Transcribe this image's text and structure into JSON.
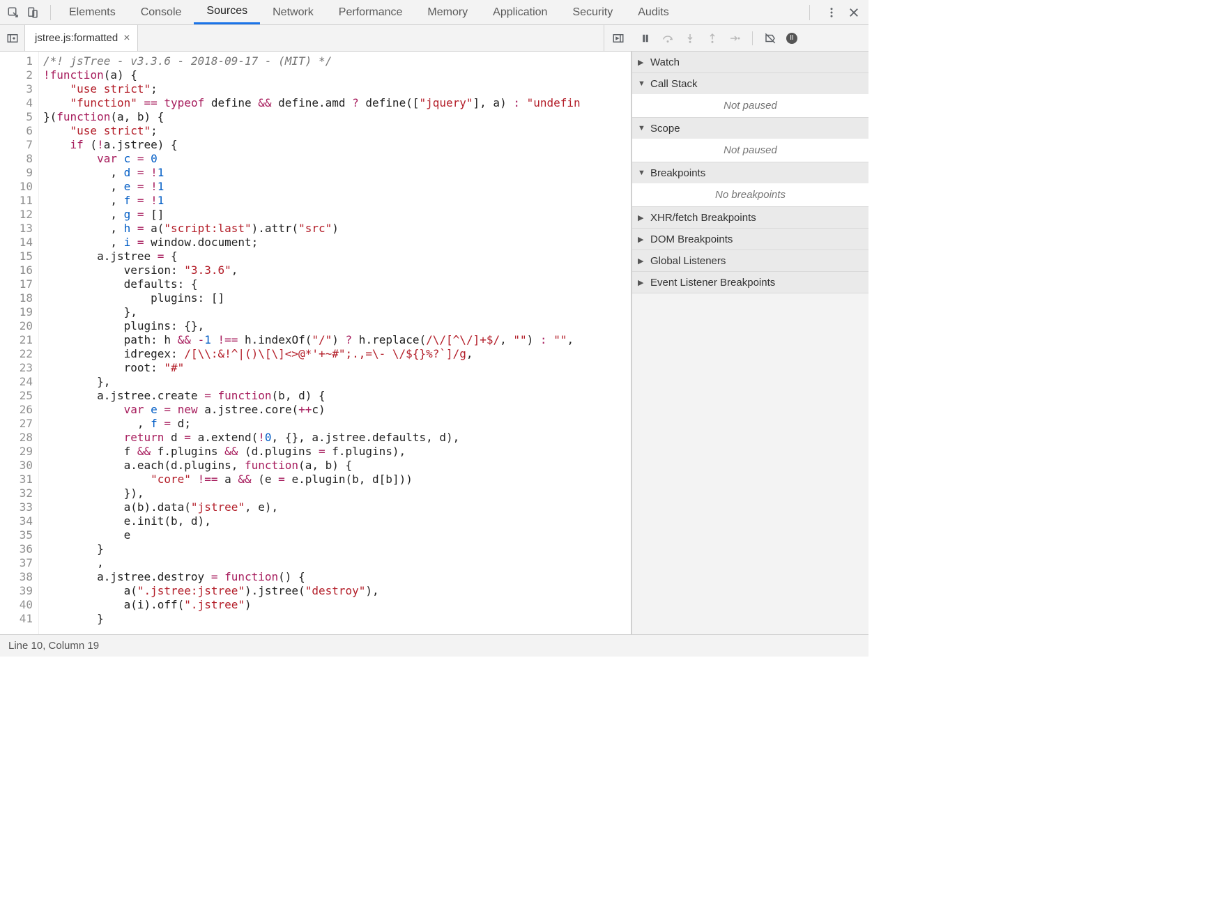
{
  "tabs": {
    "items": [
      "Elements",
      "Console",
      "Sources",
      "Network",
      "Performance",
      "Memory",
      "Application",
      "Security",
      "Audits"
    ],
    "active_index": 2
  },
  "file": {
    "name": "jstree.js:formatted"
  },
  "status": {
    "text": "Line 10, Column 19"
  },
  "debugger": {
    "sections": [
      {
        "label": "Watch",
        "expanded": false,
        "body": ""
      },
      {
        "label": "Call Stack",
        "expanded": true,
        "body": "Not paused"
      },
      {
        "label": "Scope",
        "expanded": true,
        "body": "Not paused"
      },
      {
        "label": "Breakpoints",
        "expanded": true,
        "body": "No breakpoints"
      },
      {
        "label": "XHR/fetch Breakpoints",
        "expanded": false,
        "body": ""
      },
      {
        "label": "DOM Breakpoints",
        "expanded": false,
        "body": ""
      },
      {
        "label": "Global Listeners",
        "expanded": false,
        "body": ""
      },
      {
        "label": "Event Listener Breakpoints",
        "expanded": false,
        "body": ""
      }
    ]
  },
  "debug_toolbar": {
    "icons": [
      "pause-icon",
      "step-over-icon",
      "step-into-icon",
      "step-out-icon",
      "step-icon",
      "deactivate-breakpoints-icon",
      "pause-on-exceptions-icon"
    ]
  },
  "code": {
    "first_line": 1,
    "lines": [
      [
        [
          "comment",
          "/*! jsTree - v3.3.6 - 2018-09-17 - (MIT) */"
        ]
      ],
      [
        [
          "op",
          "!"
        ],
        [
          "keyword",
          "function"
        ],
        [
          "punc",
          "("
        ],
        [
          "ident",
          "a"
        ],
        [
          "punc",
          ") {"
        ]
      ],
      [
        [
          "indent",
          "    "
        ],
        [
          "string",
          "\"use strict\""
        ],
        [
          "punc",
          ";"
        ]
      ],
      [
        [
          "indent",
          "    "
        ],
        [
          "string",
          "\"function\""
        ],
        [
          "punc",
          " "
        ],
        [
          "op",
          "=="
        ],
        [
          "punc",
          " "
        ],
        [
          "keyword",
          "typeof"
        ],
        [
          "punc",
          " define "
        ],
        [
          "op",
          "&&"
        ],
        [
          "punc",
          " define.amd "
        ],
        [
          "op",
          "?"
        ],
        [
          "punc",
          " define(["
        ],
        [
          "string",
          "\"jquery\""
        ],
        [
          "punc",
          "], a) "
        ],
        [
          "op",
          ":"
        ],
        [
          "punc",
          " "
        ],
        [
          "string",
          "\"undefin"
        ]
      ],
      [
        [
          "punc",
          "}("
        ],
        [
          "keyword",
          "function"
        ],
        [
          "punc",
          "("
        ],
        [
          "ident",
          "a"
        ],
        [
          "punc",
          ", "
        ],
        [
          "ident",
          "b"
        ],
        [
          "punc",
          ") {"
        ]
      ],
      [
        [
          "indent",
          "    "
        ],
        [
          "string",
          "\"use strict\""
        ],
        [
          "punc",
          ";"
        ]
      ],
      [
        [
          "indent",
          "    "
        ],
        [
          "keyword",
          "if"
        ],
        [
          "punc",
          " ("
        ],
        [
          "op",
          "!"
        ],
        [
          "punc",
          "a.jstree) {"
        ]
      ],
      [
        [
          "indent",
          "        "
        ],
        [
          "keyword",
          "var"
        ],
        [
          "punc",
          " "
        ],
        [
          "var",
          "c"
        ],
        [
          "punc",
          " "
        ],
        [
          "op",
          "="
        ],
        [
          "punc",
          " "
        ],
        [
          "number",
          "0"
        ]
      ],
      [
        [
          "indent",
          "          , "
        ],
        [
          "var",
          "d"
        ],
        [
          "punc",
          " "
        ],
        [
          "op",
          "="
        ],
        [
          "punc",
          " "
        ],
        [
          "op",
          "!"
        ],
        [
          "number",
          "1"
        ]
      ],
      [
        [
          "indent",
          "          , "
        ],
        [
          "var",
          "e"
        ],
        [
          "punc",
          " "
        ],
        [
          "op",
          "="
        ],
        [
          "punc",
          " "
        ],
        [
          "op",
          "!"
        ],
        [
          "number",
          "1"
        ]
      ],
      [
        [
          "indent",
          "          , "
        ],
        [
          "var",
          "f"
        ],
        [
          "punc",
          " "
        ],
        [
          "op",
          "="
        ],
        [
          "punc",
          " "
        ],
        [
          "op",
          "!"
        ],
        [
          "number",
          "1"
        ]
      ],
      [
        [
          "indent",
          "          , "
        ],
        [
          "var",
          "g"
        ],
        [
          "punc",
          " "
        ],
        [
          "op",
          "="
        ],
        [
          "punc",
          " []"
        ]
      ],
      [
        [
          "indent",
          "          , "
        ],
        [
          "var",
          "h"
        ],
        [
          "punc",
          " "
        ],
        [
          "op",
          "="
        ],
        [
          "punc",
          " a("
        ],
        [
          "string",
          "\"script:last\""
        ],
        [
          "punc",
          ").attr("
        ],
        [
          "string",
          "\"src\""
        ],
        [
          "punc",
          ")"
        ]
      ],
      [
        [
          "indent",
          "          , "
        ],
        [
          "var",
          "i"
        ],
        [
          "punc",
          " "
        ],
        [
          "op",
          "="
        ],
        [
          "punc",
          " window.document;"
        ]
      ],
      [
        [
          "indent",
          "        "
        ],
        [
          "punc",
          "a.jstree "
        ],
        [
          "op",
          "="
        ],
        [
          "punc",
          " {"
        ]
      ],
      [
        [
          "indent",
          "            "
        ],
        [
          "punc",
          "version: "
        ],
        [
          "string",
          "\"3.3.6\""
        ],
        [
          "punc",
          ","
        ]
      ],
      [
        [
          "indent",
          "            "
        ],
        [
          "punc",
          "defaults: {"
        ]
      ],
      [
        [
          "indent",
          "                "
        ],
        [
          "punc",
          "plugins: []"
        ]
      ],
      [
        [
          "indent",
          "            "
        ],
        [
          "punc",
          "},"
        ]
      ],
      [
        [
          "indent",
          "            "
        ],
        [
          "punc",
          "plugins: {},"
        ]
      ],
      [
        [
          "indent",
          "            "
        ],
        [
          "punc",
          "path: h "
        ],
        [
          "op",
          "&&"
        ],
        [
          "punc",
          " "
        ],
        [
          "op",
          "-"
        ],
        [
          "number",
          "1"
        ],
        [
          "punc",
          " "
        ],
        [
          "op",
          "!=="
        ],
        [
          "punc",
          " h.indexOf("
        ],
        [
          "string",
          "\"/\""
        ],
        [
          "punc",
          ") "
        ],
        [
          "op",
          "?"
        ],
        [
          "punc",
          " h.replace("
        ],
        [
          "regex",
          "/\\/[^\\/]+$/"
        ],
        [
          "punc",
          ", "
        ],
        [
          "string",
          "\"\""
        ],
        [
          "punc",
          ") "
        ],
        [
          "op",
          ":"
        ],
        [
          "punc",
          " "
        ],
        [
          "string",
          "\"\""
        ],
        [
          "punc",
          ","
        ]
      ],
      [
        [
          "indent",
          "            "
        ],
        [
          "punc",
          "idregex: "
        ],
        [
          "regex",
          "/[\\\\:&!^|()\\[\\]<>@*'+~#\";.,=\\- \\/${}%?`]/g"
        ],
        [
          "punc",
          ","
        ]
      ],
      [
        [
          "indent",
          "            "
        ],
        [
          "punc",
          "root: "
        ],
        [
          "string",
          "\"#\""
        ]
      ],
      [
        [
          "indent",
          "        "
        ],
        [
          "punc",
          "},"
        ]
      ],
      [
        [
          "indent",
          "        "
        ],
        [
          "punc",
          "a.jstree.create "
        ],
        [
          "op",
          "="
        ],
        [
          "punc",
          " "
        ],
        [
          "keyword",
          "function"
        ],
        [
          "punc",
          "("
        ],
        [
          "ident",
          "b"
        ],
        [
          "punc",
          ", "
        ],
        [
          "ident",
          "d"
        ],
        [
          "punc",
          ") {"
        ]
      ],
      [
        [
          "indent",
          "            "
        ],
        [
          "keyword",
          "var"
        ],
        [
          "punc",
          " "
        ],
        [
          "var",
          "e"
        ],
        [
          "punc",
          " "
        ],
        [
          "op",
          "="
        ],
        [
          "punc",
          " "
        ],
        [
          "keyword",
          "new"
        ],
        [
          "punc",
          " a.jstree.core("
        ],
        [
          "op",
          "++"
        ],
        [
          "punc",
          "c)"
        ]
      ],
      [
        [
          "indent",
          "              , "
        ],
        [
          "var",
          "f"
        ],
        [
          "punc",
          " "
        ],
        [
          "op",
          "="
        ],
        [
          "punc",
          " d;"
        ]
      ],
      [
        [
          "indent",
          "            "
        ],
        [
          "keyword",
          "return"
        ],
        [
          "punc",
          " d "
        ],
        [
          "op",
          "="
        ],
        [
          "punc",
          " a.extend("
        ],
        [
          "op",
          "!"
        ],
        [
          "number",
          "0"
        ],
        [
          "punc",
          ", {}, a.jstree.defaults, d),"
        ]
      ],
      [
        [
          "indent",
          "            "
        ],
        [
          "punc",
          "f "
        ],
        [
          "op",
          "&&"
        ],
        [
          "punc",
          " f.plugins "
        ],
        [
          "op",
          "&&"
        ],
        [
          "punc",
          " (d.plugins "
        ],
        [
          "op",
          "="
        ],
        [
          "punc",
          " f.plugins),"
        ]
      ],
      [
        [
          "indent",
          "            "
        ],
        [
          "punc",
          "a.each(d.plugins, "
        ],
        [
          "keyword",
          "function"
        ],
        [
          "punc",
          "("
        ],
        [
          "ident",
          "a"
        ],
        [
          "punc",
          ", "
        ],
        [
          "ident",
          "b"
        ],
        [
          "punc",
          ") {"
        ]
      ],
      [
        [
          "indent",
          "                "
        ],
        [
          "string",
          "\"core\""
        ],
        [
          "punc",
          " "
        ],
        [
          "op",
          "!=="
        ],
        [
          "punc",
          " a "
        ],
        [
          "op",
          "&&"
        ],
        [
          "punc",
          " (e "
        ],
        [
          "op",
          "="
        ],
        [
          "punc",
          " e.plugin(b, d[b]))"
        ]
      ],
      [
        [
          "indent",
          "            "
        ],
        [
          "punc",
          "}),"
        ]
      ],
      [
        [
          "indent",
          "            "
        ],
        [
          "punc",
          "a(b).data("
        ],
        [
          "string",
          "\"jstree\""
        ],
        [
          "punc",
          ", e),"
        ]
      ],
      [
        [
          "indent",
          "            "
        ],
        [
          "punc",
          "e.init(b, d),"
        ]
      ],
      [
        [
          "indent",
          "            "
        ],
        [
          "punc",
          "e"
        ]
      ],
      [
        [
          "indent",
          "        "
        ],
        [
          "punc",
          "}"
        ]
      ],
      [
        [
          "indent",
          "        "
        ],
        [
          "punc",
          ","
        ]
      ],
      [
        [
          "indent",
          "        "
        ],
        [
          "punc",
          "a.jstree.destroy "
        ],
        [
          "op",
          "="
        ],
        [
          "punc",
          " "
        ],
        [
          "keyword",
          "function"
        ],
        [
          "punc",
          "() {"
        ]
      ],
      [
        [
          "indent",
          "            "
        ],
        [
          "punc",
          "a("
        ],
        [
          "string",
          "\".jstree:jstree\""
        ],
        [
          "punc",
          ").jstree("
        ],
        [
          "string",
          "\"destroy\""
        ],
        [
          "punc",
          "),"
        ]
      ],
      [
        [
          "indent",
          "            "
        ],
        [
          "punc",
          "a(i).off("
        ],
        [
          "string",
          "\".jstree\""
        ],
        [
          "punc",
          ")"
        ]
      ],
      [
        [
          "indent",
          "        "
        ],
        [
          "punc",
          "}"
        ]
      ]
    ]
  }
}
